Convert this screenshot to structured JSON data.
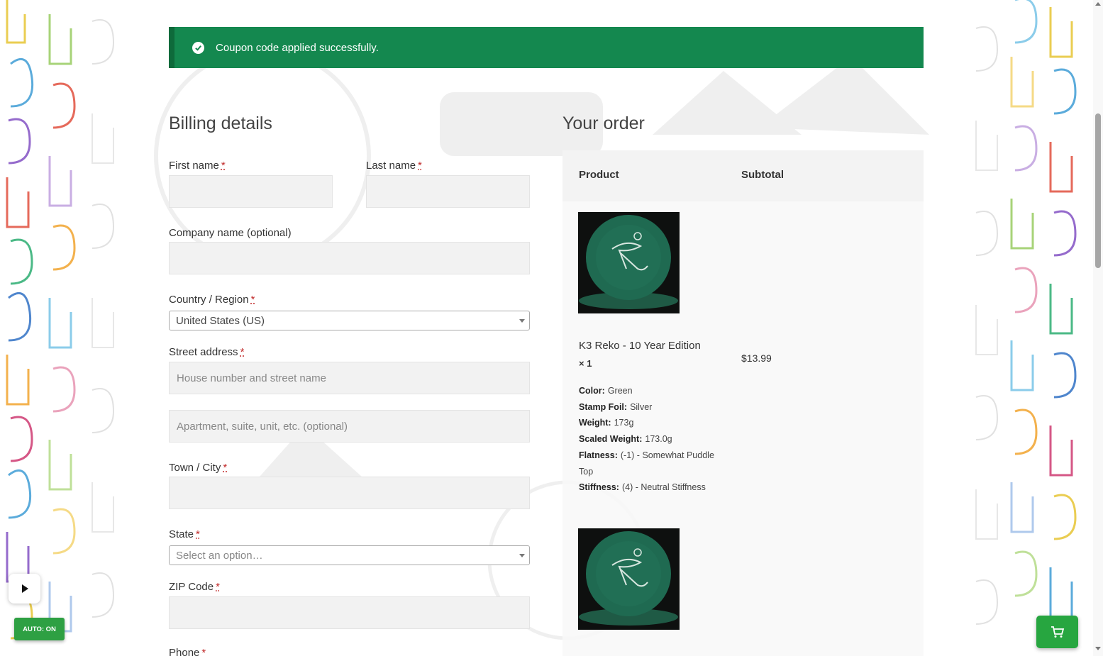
{
  "notice": {
    "message": "Coupon code applied successfully.",
    "icon": "check-circle-icon",
    "color": "#14884f"
  },
  "billing": {
    "title": "Billing details",
    "first_name_label": "First name",
    "last_name_label": "Last name",
    "company_label": "Company name (optional)",
    "country_label": "Country / Region",
    "country_value": "United States (US)",
    "street_label": "Street address",
    "street_placeholder": "House number and street name",
    "apartment_placeholder": "Apartment, suite, unit, etc. (optional)",
    "city_label": "Town / City",
    "state_label": "State",
    "state_placeholder": "Select an option…",
    "zip_label": "ZIP Code",
    "phone_label": "Phone",
    "required_marker": "*"
  },
  "order": {
    "title": "Your order",
    "col_product": "Product",
    "col_subtotal": "Subtotal",
    "items": [
      {
        "name": "K3 Reko - 10 Year Edition",
        "qty": "× 1",
        "price": "$13.99",
        "meta": [
          {
            "k": "Color:",
            "v": "Green"
          },
          {
            "k": "Stamp Foil:",
            "v": "Silver"
          },
          {
            "k": "Weight:",
            "v": "173g"
          },
          {
            "k": "Scaled Weight:",
            "v": "173.0g"
          },
          {
            "k": "Flatness:",
            "v": "(-1) - Somewhat Puddle Top"
          },
          {
            "k": "Stiffness:",
            "v": "(4) - Neutral Stiffness"
          }
        ]
      }
    ]
  },
  "widgets": {
    "play_icon": "play-icon",
    "auto_label": "AUTO: ON",
    "cart_icon": "cart-icon"
  },
  "colors": {
    "accent_green": "#14884f",
    "button_green": "#2ea043",
    "required_red": "#c12a2a"
  }
}
